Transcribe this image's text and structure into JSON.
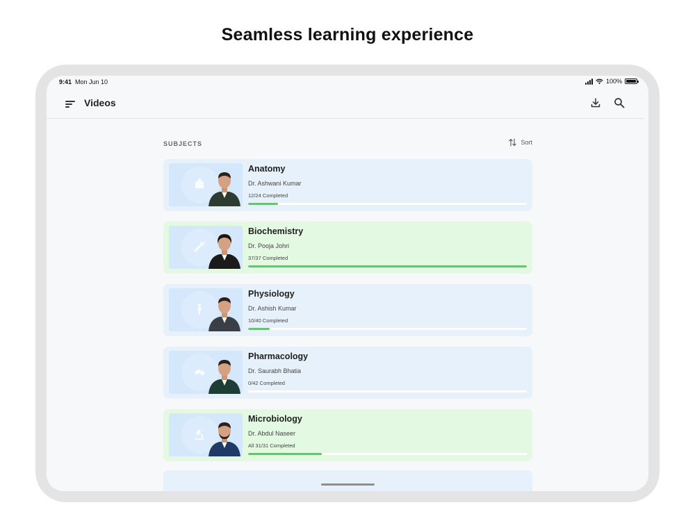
{
  "headline": "Seamless learning experience",
  "status_bar": {
    "time": "9:41",
    "date": "Mon Jun 10",
    "battery": "100%"
  },
  "navbar": {
    "title": "Videos"
  },
  "section": {
    "label": "SUBJECTS",
    "sort_label": "Sort"
  },
  "subjects": [
    {
      "name": "Anatomy",
      "teacher": "Dr. Ashwani Kumar",
      "progress_text": "12/24 Completed",
      "progress": 0.106,
      "theme": "blue",
      "icon": "anatomy-icon",
      "shirt": "#2e3b32"
    },
    {
      "name": "Biochemistry",
      "teacher": "Dr. Pooja Johri",
      "progress_text": "37/37 Completed",
      "progress": 1.0,
      "theme": "green",
      "icon": "syringe-icon",
      "shirt": "#1b1b1b"
    },
    {
      "name": "Physiology",
      "teacher": "Dr. Ashish Kumar",
      "progress_text": "10/40 Completed",
      "progress": 0.078,
      "theme": "blue",
      "icon": "body-icon",
      "shirt": "#3a3f47"
    },
    {
      "name": "Pharmacology",
      "teacher": "Dr. Saurabh Bhatia",
      "progress_text": "0/42 Completed",
      "progress": 0.0,
      "theme": "blue",
      "icon": "pills-icon",
      "shirt": "#1e3d35"
    },
    {
      "name": "Microbiology",
      "teacher": "Dr. Abdul Naseer",
      "progress_text": "All 31/31 Completed",
      "progress": 0.265,
      "theme": "green",
      "icon": "microscope-icon",
      "shirt": "#1f3a66"
    }
  ],
  "colors": {
    "progress": "#6cbf75",
    "card_blue": "#e7f1fb",
    "card_green": "#e3f9e2"
  }
}
